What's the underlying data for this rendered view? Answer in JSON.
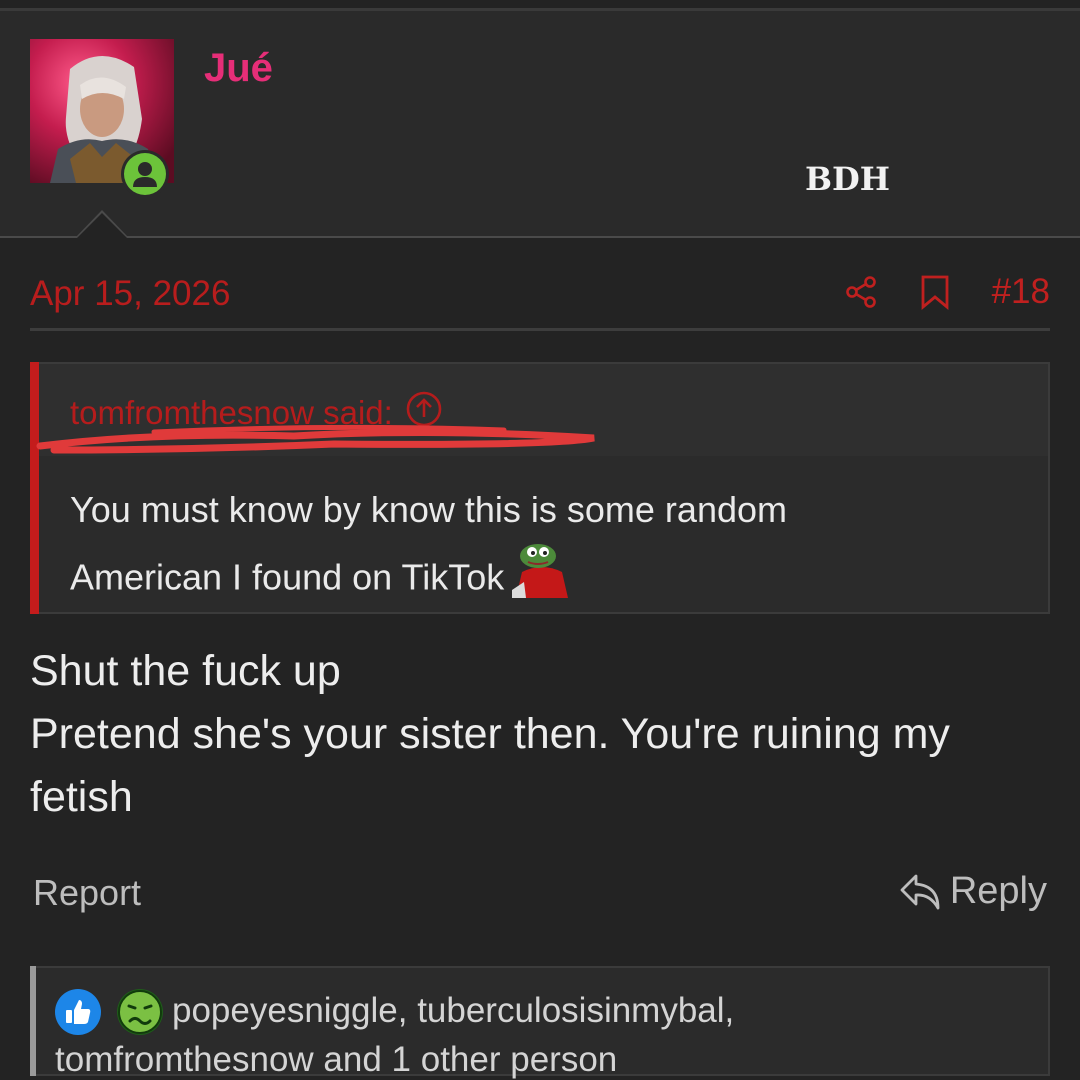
{
  "user": {
    "name": "Jué",
    "title": "BDH",
    "status": "online"
  },
  "post": {
    "date": "Apr 15, 2026",
    "number": "#18",
    "quote": {
      "author": "tomfromthesnow said:",
      "line1": "You must know by know this is some random",
      "line2": "American I found on TikTok"
    },
    "body": [
      "Shut the fuck up",
      "Pretend she's your sister then. You're ruining my",
      "fetish"
    ],
    "report_label": "Report",
    "reply_label": "Reply"
  },
  "reactions": {
    "line1": "popeyesniggle, tuberculosisinmybal,",
    "line2": "tomfromthesnow and 1 other person"
  },
  "colors": {
    "accent": "#c0201f",
    "username": "#e62e78",
    "online": "#6cc33a",
    "like": "#1d86e8"
  },
  "icons": {
    "share": "share-icon",
    "bookmark": "bookmark-icon",
    "reply": "reply-arrow-icon",
    "quote_jump": "arrow-up-circle-icon",
    "like": "thumbs-up-icon",
    "sick": "sick-face-icon"
  }
}
